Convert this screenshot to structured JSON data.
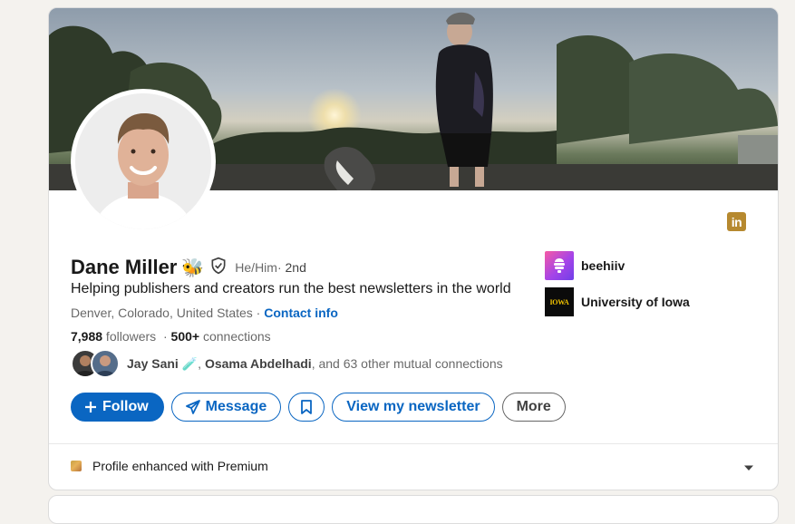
{
  "profile": {
    "name": "Dane Miller",
    "name_emoji": "🐝",
    "pronouns": "He/Him",
    "degree_sep": " · ",
    "degree": "2nd",
    "headline": "Helping publishers and creators run the best newsletters in the world",
    "location": "Denver, Colorado, United States",
    "location_sep": " · ",
    "contact_info_label": "Contact info",
    "followers_count": "7,988",
    "followers_label": " followers",
    "stats_sep": "  · ",
    "connections_count": "500+",
    "connections_label": " connections"
  },
  "mutual": {
    "person1": "Jay Sani",
    "person1_emoji": "🧪",
    "separator": ", ",
    "person2": "Osama Abdelhadi",
    "rest": ", and 63 other mutual connections"
  },
  "actions": {
    "follow_label": "Follow",
    "message_label": "Message",
    "newsletter_label": "View my newsletter",
    "more_label": "More"
  },
  "orgs": [
    {
      "name": "beehiiv"
    },
    {
      "name": "University of Iowa",
      "logo_text": "IOWA"
    }
  ],
  "premium": {
    "label": "Profile enhanced with Premium"
  },
  "linkedin_badge": "in",
  "colors": {
    "brand_blue": "#0a66c2",
    "premium_gold": "#b6892f"
  },
  "icons": {
    "verified": "shield-check-icon",
    "message": "paper-plane-icon",
    "save": "bookmark-icon",
    "follow": "plus-icon",
    "expand": "caret-down-icon"
  }
}
